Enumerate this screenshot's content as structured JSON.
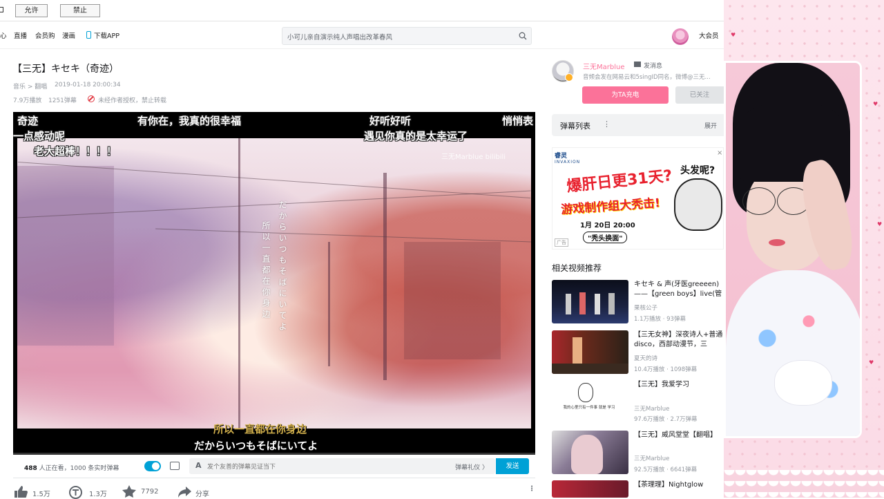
{
  "permission_bar": {
    "allow": "允许",
    "deny": "禁止"
  },
  "header": {
    "nav": [
      "心",
      "直播",
      "会员购",
      "漫画"
    ],
    "download_app": "下载APP",
    "search_placeholder": "小可儿亲自演示纯人声唱出改革春风",
    "vip": "大会员"
  },
  "video": {
    "title": "【三无】キセキ（奇迹）",
    "category": "音乐 > 翻唱",
    "date": "2019-01-18 20:00:34",
    "views": "7.9万播放",
    "danmaku_count": "1251弹幕",
    "notice": "未经作者授权，禁止转载",
    "progress": 0.0
  },
  "player": {
    "danmaku": [
      "奇迹",
      "有你在，我真的很幸福",
      "好听好听",
      "悄悄表",
      "一点感动呢",
      "遇见你真的是太幸运了",
      "老大超棒！！！！"
    ],
    "watermark": "三无Marblue bilibili",
    "vertical_lyric_jp": "だからいつもそばにいてよ",
    "vertical_lyric_cn": "所以一直都在你身边",
    "subtitle_cn": "所以一直都在你身边",
    "subtitle_jp": "だからいつもそばにいてよ"
  },
  "send_bar": {
    "watching": "488",
    "watching_suffix": "人正在看，1000 条实时弹幕",
    "input_placeholder": "发个友善的弹幕见证当下",
    "etiquette": "弹幕礼仪 〉",
    "send": "发送"
  },
  "toolbar": {
    "like": "1.5万",
    "coin": "1.3万",
    "fav": "7792",
    "share": "分享"
  },
  "uploader": {
    "name": "三无Marblue",
    "message": "发消息",
    "desc": "音频会发在网易云和5singID同名，微博@三无...",
    "charge": "为TA充电",
    "followed": "已关注"
  },
  "danmaku_list": {
    "title": "弹幕列表",
    "expand": "展开"
  },
  "ad": {
    "brand": "睿灵",
    "brand_sub": "INVAXION",
    "headline": "爆肝日更31天?",
    "subhead": "游戏制作组大秃击!",
    "date": "1月 20日 20:00",
    "tag": "\"秃头换面\"",
    "question": "头发呢?",
    "label": "广告"
  },
  "related": {
    "title": "相关视频推荐",
    "items": [
      {
        "title": "キセキ & 声(牙医greeeen)——【green boys】live(管",
        "author": "果核公子",
        "stats": "1.1万播放 · 93弹幕"
      },
      {
        "title": "【三无女神】深夜诗人+普通disco，西部动漫节，三",
        "author": "夏天的诗",
        "stats": "10.4万播放 · 1098弹幕"
      },
      {
        "title": "【三无】我爱学习",
        "author": "三无Marblue",
        "stats": "97.6万播放 · 2.7万弹幕",
        "thumb_text": "我的心里只有一件事 就是 学习"
      },
      {
        "title": "【三无】威风堂堂【翻唱】",
        "author": "三无Marblue",
        "stats": "92.5万播放 · 6641弹幕"
      },
      {
        "title": "【茶理理】Nightglow",
        "author": "",
        "stats": ""
      }
    ]
  }
}
